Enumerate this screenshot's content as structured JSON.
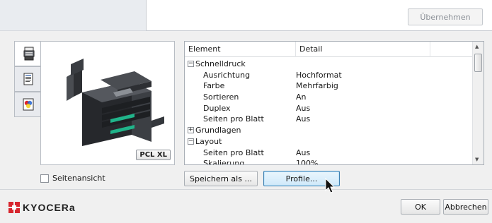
{
  "header": {
    "apply_label": "Übernehmen"
  },
  "tabs": [
    {
      "icon": "printer-icon"
    },
    {
      "icon": "document-icon"
    },
    {
      "icon": "color-icon"
    }
  ],
  "preview": {
    "badge": "PCL XL",
    "page_view_label": "Seitenansicht"
  },
  "table": {
    "columns": [
      "Element",
      "Detail"
    ],
    "rows": [
      {
        "kind": "group",
        "expanded": true,
        "element": "Schnelldruck",
        "detail": ""
      },
      {
        "kind": "item",
        "element": "Ausrichtung",
        "detail": "Hochformat"
      },
      {
        "kind": "item",
        "element": "Farbe",
        "detail": "Mehrfarbig"
      },
      {
        "kind": "item",
        "element": "Sortieren",
        "detail": "An"
      },
      {
        "kind": "item",
        "element": "Duplex",
        "detail": "Aus"
      },
      {
        "kind": "item",
        "element": "Seiten pro Blatt",
        "detail": "Aus"
      },
      {
        "kind": "group",
        "expanded": false,
        "element": "Grundlagen",
        "detail": ""
      },
      {
        "kind": "group",
        "expanded": true,
        "element": "Layout",
        "detail": ""
      },
      {
        "kind": "item",
        "element": "Seiten pro Blatt",
        "detail": "Aus"
      },
      {
        "kind": "item",
        "element": "Skalierung",
        "detail": "100%"
      }
    ]
  },
  "actions": {
    "save_as_label": "Speichern als ...",
    "profiles_label": "Profile..."
  },
  "footer": {
    "brand": "KYOCERa",
    "ok_label": "OK",
    "cancel_label": "Abbrechen"
  },
  "colors": {
    "brand_red": "#d7262e",
    "focus_blue": "#3c7fb1"
  }
}
